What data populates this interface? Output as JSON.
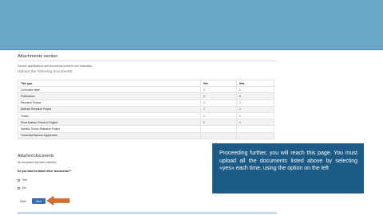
{
  "attachments": {
    "section_title": "Attachments section",
    "subtitle": "Declare qualifications and documents useful for the evaluation.",
    "upload_title": "Upload the following documents:",
    "table": {
      "headers": [
        "Title type",
        "Min",
        "Max"
      ],
      "rows": [
        {
          "title": "Curriculum vitae",
          "min": "1",
          "max": "1"
        },
        {
          "title": "Publications",
          "min": "0",
          "max": "8"
        },
        {
          "title": "Research Project",
          "min": "1",
          "max": "1"
        },
        {
          "title": "Abstract Research Project",
          "min": "1",
          "max": "1"
        },
        {
          "title": "Thesis",
          "min": "1",
          "max": "1"
        },
        {
          "title": "Short Abstract Thesis in English",
          "min": "1",
          "max": "1"
        },
        {
          "title": "Specific Theme Research Project",
          "min": "",
          "max": ""
        },
        {
          "title": "Transcript/Diploma Supplement",
          "min": "",
          "max": ""
        }
      ]
    }
  },
  "attached": {
    "title": "Attached documents",
    "empty_text": "No document has been inserted.",
    "question": "Do you want to attach other documents?*",
    "options": [
      "Yes",
      "No"
    ]
  },
  "buttons": {
    "back": "Back",
    "next": "Next"
  },
  "tooltip": {
    "text": "Proceeding further, you will reach this page. You must upload all the documents listed above by selecting «yes» each time, using the option on the left"
  },
  "colors": {
    "banner": "#6aa6c8",
    "tooltip_bg": "#1c5b86",
    "next_button": "#2f6db6",
    "arrow": "#e06a2a"
  }
}
